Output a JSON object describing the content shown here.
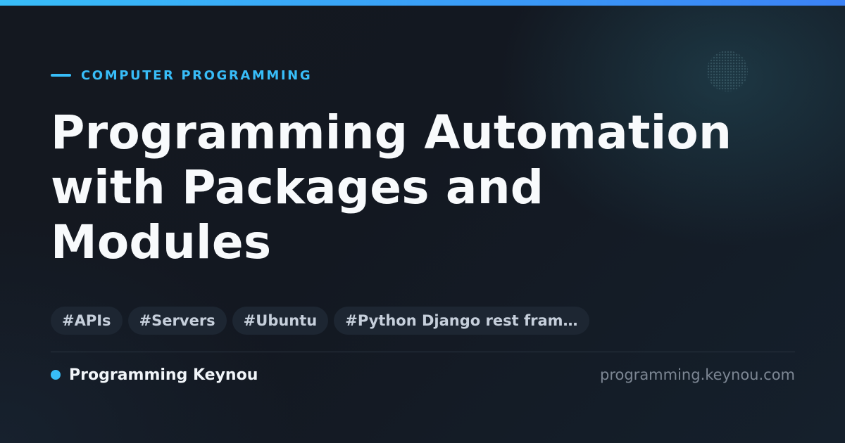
{
  "colors": {
    "accent": "#38bdf8",
    "background": "#131821",
    "title": "#f8fafc",
    "tag_background": "#1d2632",
    "tag_text": "#c6cfdb",
    "muted": "#7d8794"
  },
  "category": {
    "label": "COMPUTER PROGRAMMING"
  },
  "title": {
    "lines": [
      "Programming Automation",
      "with Packages and",
      "Modules"
    ]
  },
  "tags": [
    {
      "label": "#APIs"
    },
    {
      "label": "#Servers"
    },
    {
      "label": "#Ubuntu"
    },
    {
      "label": "#Python Django rest fram…"
    }
  ],
  "footer": {
    "site_name": "Programming Keynou",
    "domain": "programming.keynou.com"
  }
}
